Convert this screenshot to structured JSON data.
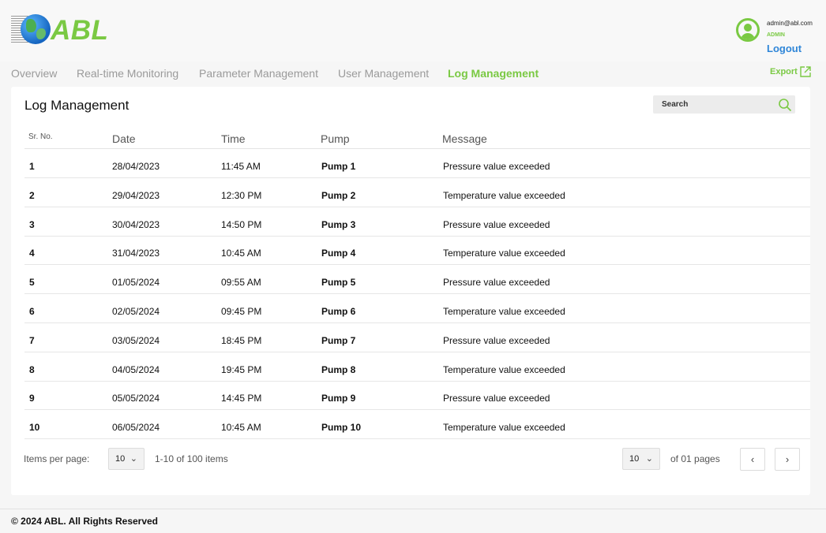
{
  "brand": {
    "logo_text": "ABL",
    "accent": "#7ac943",
    "link": "#2f86d8"
  },
  "user": {
    "email": "admin@abl.com",
    "role": "ADMIN",
    "logout": "Logout"
  },
  "nav": {
    "tabs": [
      "Overview",
      "Real-time Monitoring",
      "Parameter Management",
      "User Management",
      "Log Management"
    ],
    "active": "Log Management",
    "export": "Export"
  },
  "page": {
    "title": "Log Management",
    "search": {
      "placeholder": "Search"
    }
  },
  "table": {
    "headers": {
      "srno": "Sr. No.",
      "date": "Date",
      "time": "Time",
      "pump": "Pump",
      "message": "Message"
    },
    "rows": [
      {
        "srno": "1",
        "date": "28/04/2023",
        "time": "11:45 AM",
        "pump": "Pump 1",
        "message": "Pressure value exceeded"
      },
      {
        "srno": "2",
        "date": "29/04/2023",
        "time": "12:30 PM",
        "pump": "Pump 2",
        "message": "Temperature value exceeded"
      },
      {
        "srno": "3",
        "date": "30/04/2023",
        "time": "14:50 PM",
        "pump": "Pump 3",
        "message": "Pressure value exceeded"
      },
      {
        "srno": "4",
        "date": "31/04/2023",
        "time": "10:45 AM",
        "pump": "Pump 4",
        "message": "Temperature value exceeded"
      },
      {
        "srno": "5",
        "date": "01/05/2024",
        "time": "09:55 AM",
        "pump": "Pump 5",
        "message": "Pressure value exceeded"
      },
      {
        "srno": "6",
        "date": "02/05/2024",
        "time": "09:45 PM",
        "pump": "Pump 6",
        "message": "Temperature value exceeded"
      },
      {
        "srno": "7",
        "date": "03/05/2024",
        "time": "18:45 PM",
        "pump": "Pump 7",
        "message": "Pressure value exceeded"
      },
      {
        "srno": "8",
        "date": "04/05/2024",
        "time": "19:45 PM",
        "pump": "Pump 8",
        "message": "Temperature value exceeded"
      },
      {
        "srno": "9",
        "date": "05/05/2024",
        "time": "14:45 PM",
        "pump": "Pump 9",
        "message": "Pressure value exceeded"
      },
      {
        "srno": "10",
        "date": "06/05/2024",
        "time": "10:45 AM",
        "pump": "Pump 10",
        "message": "Temperature value exceeded"
      }
    ]
  },
  "pagination": {
    "items_per_page_label": "Items per page:",
    "items_per_page": "10",
    "range": "1-10 of 100 items",
    "page_select": "10",
    "pages_label": "of 01 pages",
    "prev_icon": "chevron-left-icon",
    "next_icon": "chevron-right-icon"
  },
  "footer": {
    "text": "© 2024 ABL. All Rights Reserved"
  }
}
